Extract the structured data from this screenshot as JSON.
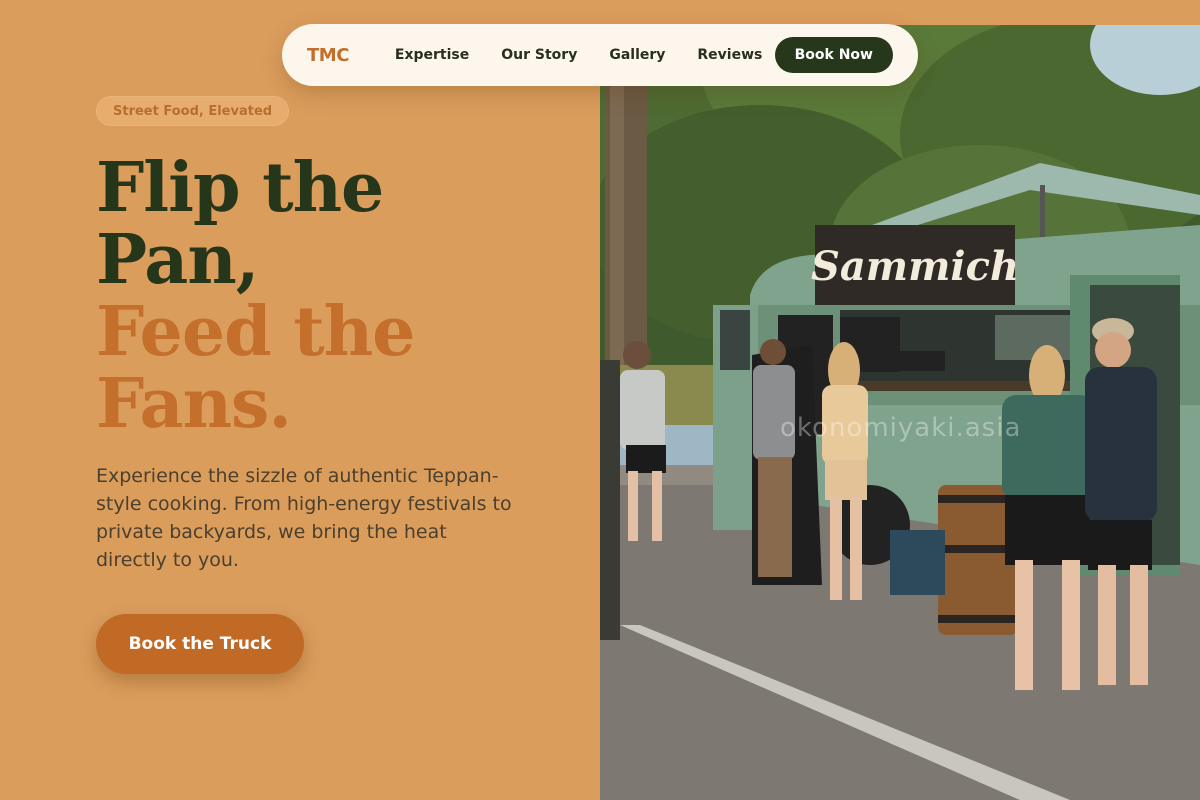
{
  "nav": {
    "logo": "TMC",
    "links": [
      "Expertise",
      "Our Story",
      "Gallery",
      "Reviews"
    ],
    "cta": "Book Now"
  },
  "hero": {
    "badge": "Street Food, Elevated",
    "headline": {
      "line1": "Flip the",
      "line2": "Pan,",
      "line3": "Feed the",
      "line4": "Fans."
    },
    "description": "Experience the sizzle of authentic Teppan-style cooking. From high-energy festivals to private backyards, we bring the heat directly to you.",
    "cta": "Book the Truck"
  },
  "image": {
    "truck_sign": "Sammich",
    "watermark": "okonomiyaki.asia"
  },
  "colors": {
    "background": "#DB9D5C",
    "nav_background": "#FDF6EC",
    "brand_orange": "#C4702C",
    "dark_green": "#26361B",
    "button_dark": "#27371C"
  }
}
